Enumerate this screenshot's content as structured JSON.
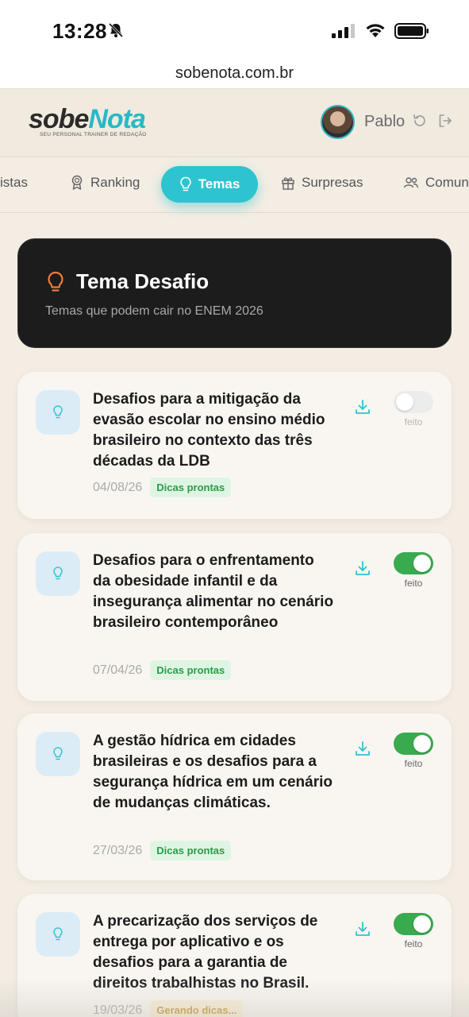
{
  "status": {
    "time": "13:28"
  },
  "browser": {
    "url": "sobenota.com.br"
  },
  "header": {
    "logo_part1": "sobe",
    "logo_part2": "Nota",
    "logo_tagline": "SEU PERSONAL TRAINER DE REDAÇÃO",
    "username": "Pablo"
  },
  "tabs": [
    {
      "label": "istas",
      "icon": "list-icon"
    },
    {
      "label": "Ranking",
      "icon": "medal-icon"
    },
    {
      "label": "Temas",
      "icon": "lightbulb-icon",
      "active": true
    },
    {
      "label": "Surpresas",
      "icon": "gift-icon"
    },
    {
      "label": "Comun",
      "icon": "users-icon"
    }
  ],
  "hero": {
    "title": "Tema Desafio",
    "subtitle": "Temas que podem cair no ENEM 2026"
  },
  "themes": [
    {
      "title": "Desafios para a mitigação da evasão escolar no ensino médio brasileiro no contexto das três décadas da LDB",
      "date": "04/08/26",
      "badge": "Dicas prontas",
      "done": false,
      "done_label": "feito"
    },
    {
      "title": "Desafios para o enfrentamento da obesidade infantil e da insegurança alimentar no cenário brasileiro contemporâneo",
      "date": "07/04/26",
      "badge": "Dicas prontas",
      "done": true,
      "done_label": "feito"
    },
    {
      "title": "A gestão hídrica em cidades brasileiras e os desafios para a segurança hídrica em um cenário de mudanças climáticas.",
      "date": "27/03/26",
      "badge": "Dicas prontas",
      "done": true,
      "done_label": "feito"
    },
    {
      "title": "A precarização dos serviços de entrega por aplicativo e os desafios para a garantia de direitos trabalhistas no Brasil.",
      "date": "19/03/26",
      "badge": "Gerando dicas...",
      "done": true,
      "done_label": "feito"
    }
  ],
  "colors": {
    "accent": "#2ec4cf",
    "toggle_on": "#3aaa4f",
    "hero_bg": "#1c1c1c",
    "bulb_orange": "#f07a3a"
  }
}
